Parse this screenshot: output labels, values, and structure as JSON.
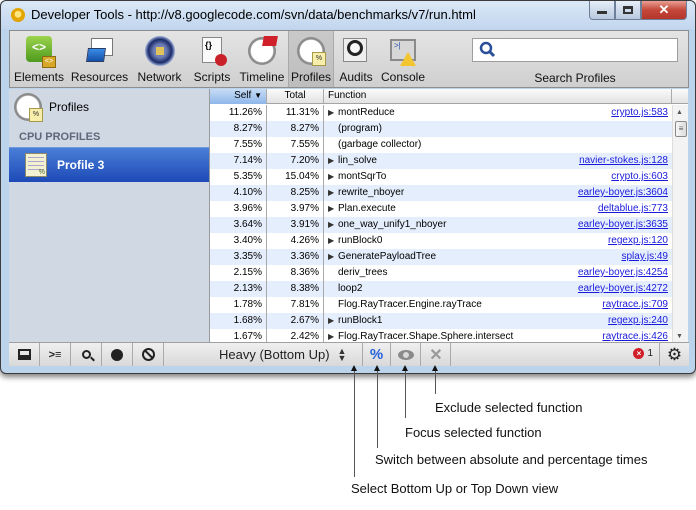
{
  "window": {
    "title": "Developer Tools - http://v8.googlecode.com/svn/data/benchmarks/v7/run.html",
    "buttons": [
      "minimize",
      "maximize",
      "close"
    ]
  },
  "toolbar": {
    "tools": [
      {
        "label": "Elements",
        "icon": "elements-icon",
        "active": false
      },
      {
        "label": "Resources",
        "icon": "resources-icon",
        "active": false
      },
      {
        "label": "Network",
        "icon": "network-icon",
        "active": false
      },
      {
        "label": "Scripts",
        "icon": "scripts-icon",
        "active": false
      },
      {
        "label": "Timeline",
        "icon": "timeline-icon",
        "active": false
      },
      {
        "label": "Profiles",
        "icon": "profiles-icon",
        "active": true
      },
      {
        "label": "Audits",
        "icon": "audits-icon",
        "active": false
      },
      {
        "label": "Console",
        "icon": "console-icon",
        "active": false
      }
    ],
    "search": {
      "label": "Search Profiles",
      "value": ""
    }
  },
  "sidebar": {
    "root_label": "Profiles",
    "section_title": "CPU PROFILES",
    "items": [
      {
        "label": "Profile 3",
        "selected": true
      }
    ]
  },
  "grid": {
    "columns": [
      "Self",
      "Total",
      "Function"
    ],
    "sort_column": "Self",
    "sort_direction": "descending",
    "rows": [
      {
        "self": "11.26%",
        "total": "11.31%",
        "function": "montReduce",
        "expandable": true,
        "link": "crypto.js:583"
      },
      {
        "self": "8.27%",
        "total": "8.27%",
        "function": "(program)",
        "expandable": false,
        "link": ""
      },
      {
        "self": "7.55%",
        "total": "7.55%",
        "function": "(garbage collector)",
        "expandable": false,
        "link": ""
      },
      {
        "self": "7.14%",
        "total": "7.20%",
        "function": "lin_solve",
        "expandable": true,
        "link": "navier-stokes.js:128"
      },
      {
        "self": "5.35%",
        "total": "15.04%",
        "function": "montSqrTo",
        "expandable": true,
        "link": "crypto.js:603"
      },
      {
        "self": "4.10%",
        "total": "8.25%",
        "function": "rewrite_nboyer",
        "expandable": true,
        "link": "earley-boyer.js:3604"
      },
      {
        "self": "3.96%",
        "total": "3.97%",
        "function": "Plan.execute",
        "expandable": true,
        "link": "deltablue.js:773"
      },
      {
        "self": "3.64%",
        "total": "3.91%",
        "function": "one_way_unify1_nboyer",
        "expandable": true,
        "link": "earley-boyer.js:3635"
      },
      {
        "self": "3.40%",
        "total": "4.26%",
        "function": "runBlock0",
        "expandable": true,
        "link": "regexp.js:120"
      },
      {
        "self": "3.35%",
        "total": "3.36%",
        "function": "GeneratePayloadTree",
        "expandable": true,
        "link": "splay.js:49"
      },
      {
        "self": "2.15%",
        "total": "8.36%",
        "function": "deriv_trees",
        "expandable": false,
        "link": "earley-boyer.js:4254"
      },
      {
        "self": "2.13%",
        "total": "8.38%",
        "function": "loop2",
        "expandable": false,
        "link": "earley-boyer.js:4272"
      },
      {
        "self": "1.78%",
        "total": "7.81%",
        "function": "Flog.RayTracer.Engine.rayTrace",
        "expandable": false,
        "link": "raytrace.js:709"
      },
      {
        "self": "1.68%",
        "total": "2.67%",
        "function": "runBlock1",
        "expandable": true,
        "link": "regexp.js:240"
      },
      {
        "self": "1.67%",
        "total": "2.42%",
        "function": "Flog.RayTracer.Shape.Sphere.intersect",
        "expandable": true,
        "link": "raytrace.js:426"
      }
    ]
  },
  "statusbar": {
    "view_mode": "Heavy (Bottom Up)",
    "percent_label": "%",
    "focus_label": "eye",
    "exclude_label": "✕",
    "error_count": "1",
    "error_glyph": "×"
  },
  "callouts": {
    "exclude": "Exclude selected function",
    "focus": "Focus selected function",
    "percent": "Switch between absolute and percentage times",
    "view": "Select Bottom Up or Top Down view"
  },
  "colors": {
    "accent": "#2460d8",
    "selection": "#1d4ab7",
    "link": "#1a1adb",
    "error": "#d01f2a"
  }
}
